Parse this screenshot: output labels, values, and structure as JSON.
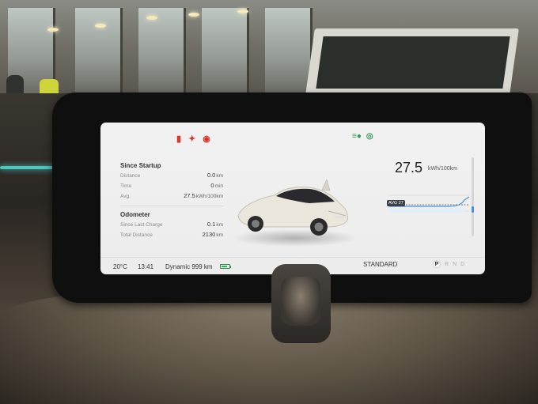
{
  "warning_icons": [
    "seatbelt-warning-icon",
    "occupant-warning-icon",
    "parking-brake-icon"
  ],
  "indicator_lamps": [
    "low-beam-icon",
    "auto-hold-icon"
  ],
  "since_startup": {
    "title": "Since Startup",
    "rows": [
      {
        "label": "Distance",
        "value": "0.0",
        "unit": "km"
      },
      {
        "label": "Time",
        "value": "0",
        "unit": "min"
      },
      {
        "label": "Avg.",
        "value": "27.5",
        "unit": "kWh/100km"
      }
    ]
  },
  "odometer": {
    "title": "Odometer",
    "rows": [
      {
        "label": "Since Last Charge",
        "value": "0.1",
        "unit": "km"
      },
      {
        "label": "Total Distance",
        "value": "2130",
        "unit": "km"
      }
    ]
  },
  "consumption": {
    "value": "27.5",
    "unit": "kWh/100km",
    "avg_label": "AVG 27",
    "accent": "#4c8fd6"
  },
  "status_bar": {
    "temperature": "20°C",
    "time": "13:41",
    "mode": "Dynamic 999 km",
    "battery_level": 0.8,
    "drive_mode": "STANDARD",
    "gears": [
      "P",
      "R",
      "N",
      "D"
    ],
    "active_gear": "P"
  },
  "colors": {
    "warning": "#d23a2f",
    "indicator": "#2d9a55",
    "screen_bg": "#efefef"
  }
}
